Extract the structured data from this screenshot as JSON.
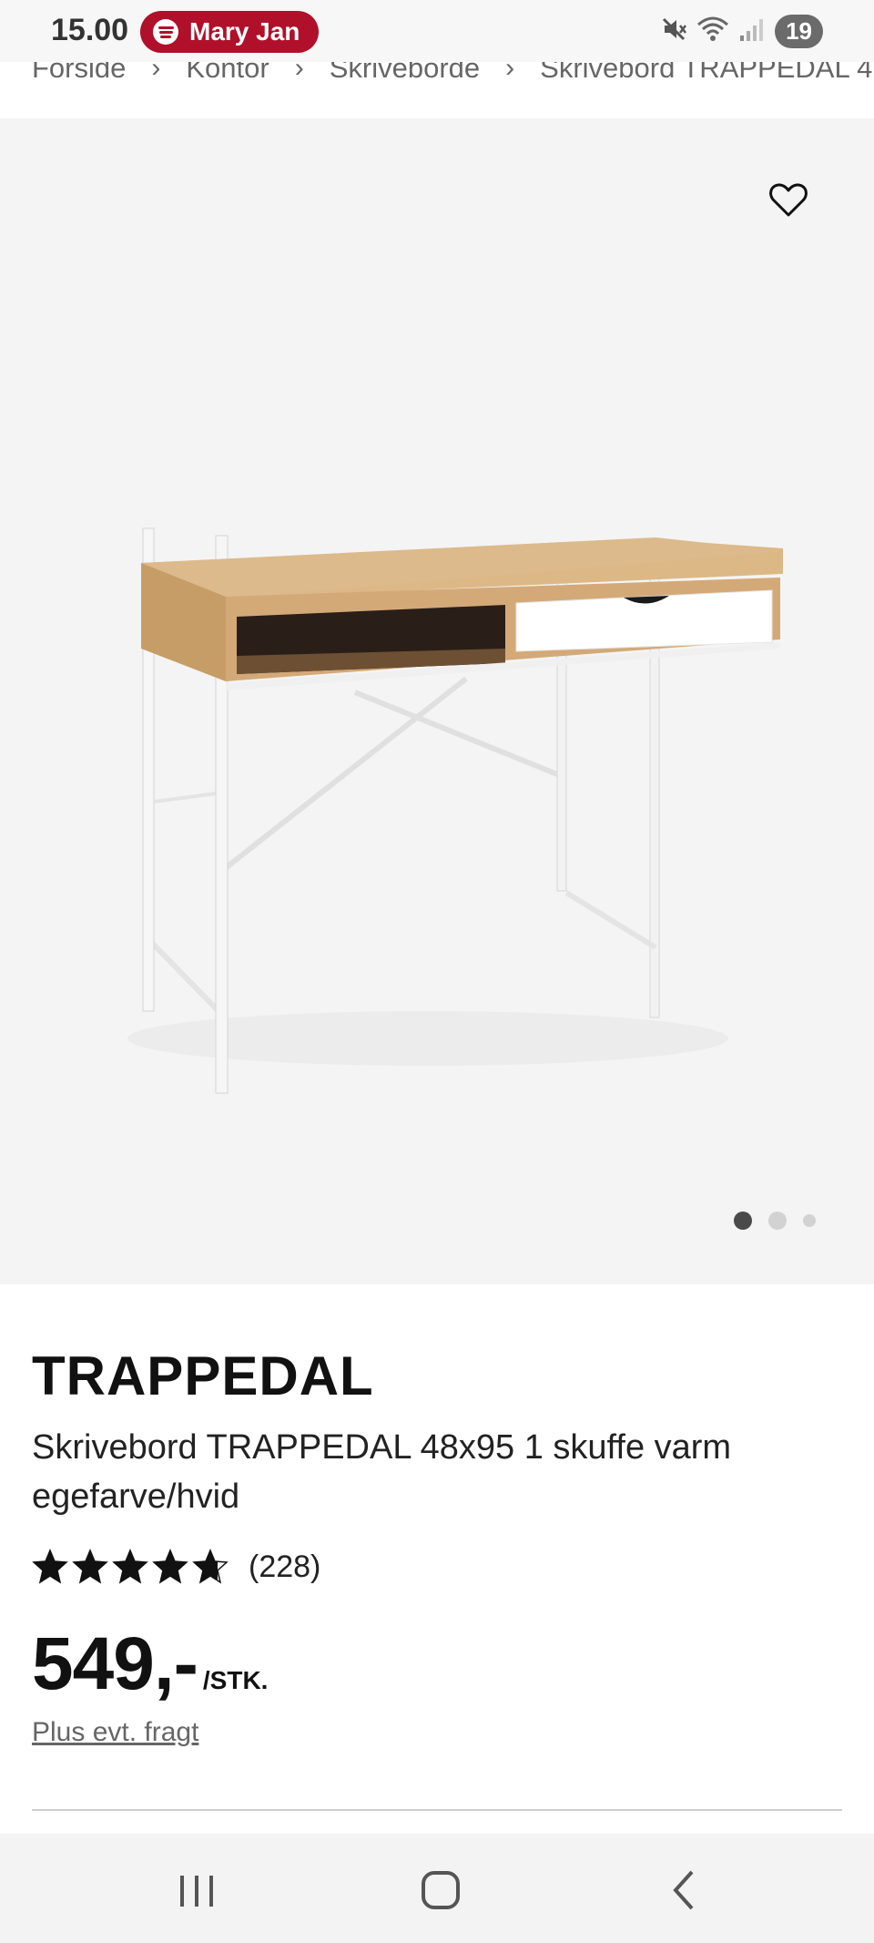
{
  "status_bar": {
    "time": "15.00",
    "media_title": "Mary Jan",
    "notification_count": "19",
    "icons": [
      "spotify-icon",
      "mute-icon",
      "wifi-icon",
      "signal-icon"
    ]
  },
  "breadcrumb": [
    "Forside",
    "Kontor",
    "Skriveborde",
    "Skrivebord TRAPPEDAL 4"
  ],
  "gallery": {
    "image_count": 3,
    "active_index": 0,
    "favorite_icon": "heart-outline-icon"
  },
  "product": {
    "brand": "TRAPPEDAL",
    "name": "Skrivebord TRAPPEDAL 48x95 1 skuffe varm egefarve/hvid",
    "rating_value": 4.7,
    "rating_max": 5,
    "rating_count": "(228)",
    "price": "549,-",
    "price_unit": "/STK.",
    "shipping_note": "Plus evt. fragt"
  },
  "nav_bar": {
    "icons": [
      "recent-apps-icon",
      "home-icon",
      "back-icon"
    ]
  },
  "colors": {
    "spotify_pill": "#b0102a",
    "gallery_bg": "#f4f4f4",
    "text": "#111111"
  }
}
